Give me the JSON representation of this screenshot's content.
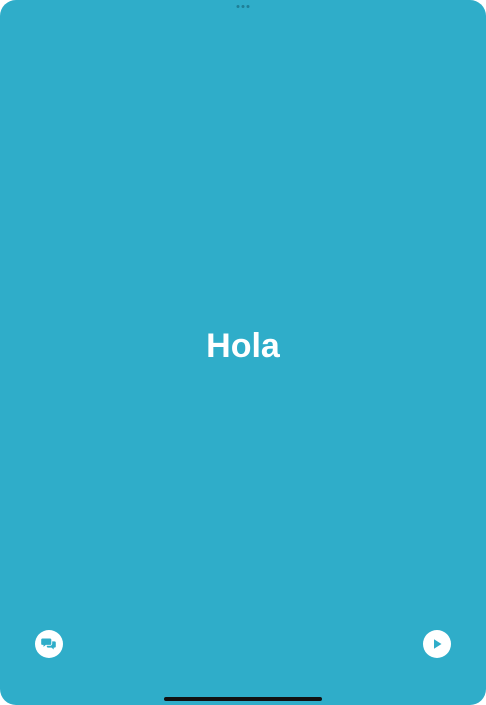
{
  "theme": {
    "background": "#2fadc9",
    "text": "#ffffff",
    "icon_fill": "#2fadc9"
  },
  "phrase": {
    "text": "Hola"
  },
  "buttons": {
    "left_icon": "speech-bubbles-icon",
    "right_icon": "play-icon"
  }
}
